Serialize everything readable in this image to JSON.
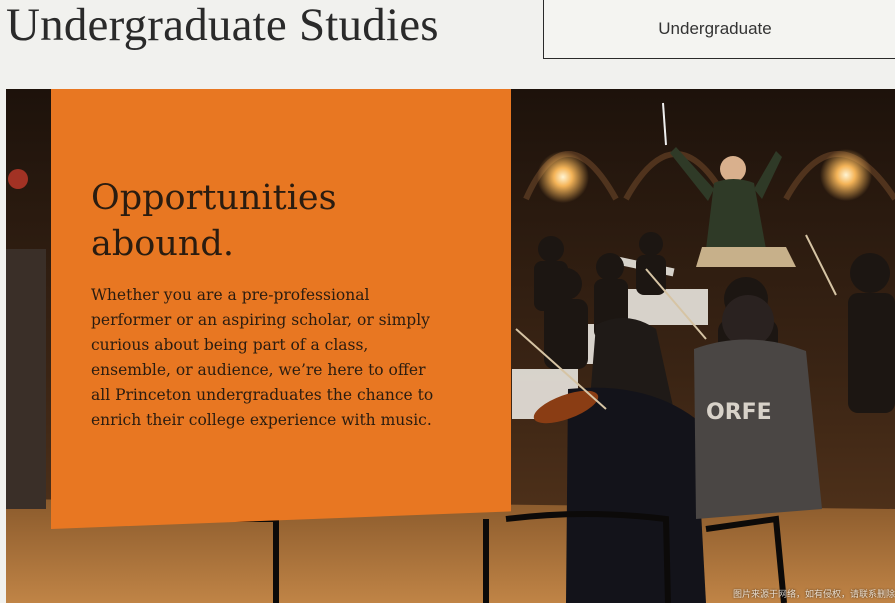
{
  "header": {
    "title": "Undergraduate Studies",
    "nav_button_label": "Undergraduate"
  },
  "hero": {
    "image_subject": "orchestra rehearsal with conductor",
    "panel_color": "#e87722",
    "heading_line1": "Opportunities",
    "heading_line2": "abound.",
    "body": "Whether you are a pre-professional performer or an aspiring scholar, or simply curious about being part of a class, ensemble, or audience, we’re here to offer all Princeton undergraduates the chance to enrich their college experience with music.",
    "sweatshirt_text": "ORFE",
    "watermark": "图片来源于网络，如有侵权，请联系删除"
  }
}
